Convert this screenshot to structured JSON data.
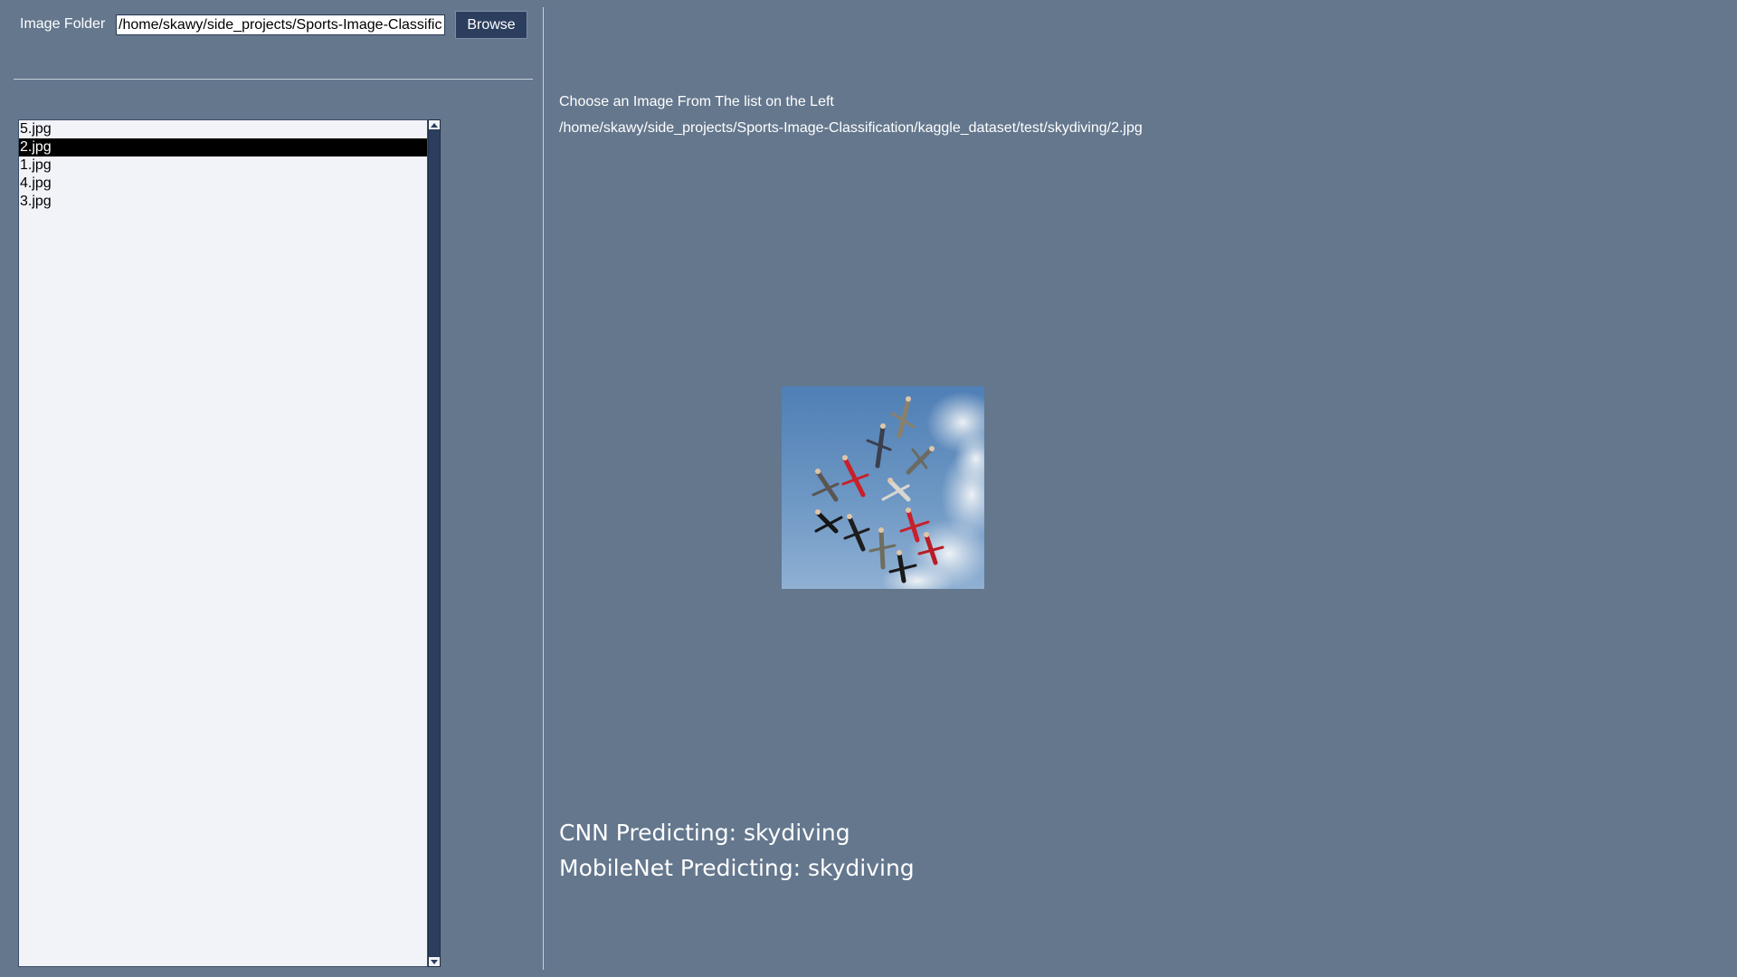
{
  "folder": {
    "label": "Image Folder",
    "path": "/home/skawy/side_projects/Sports-Image-Classification/kaggle_dataset/test/skydiving",
    "browse_label": "Browse"
  },
  "file_list": {
    "items": [
      "5.jpg",
      "2.jpg",
      "1.jpg",
      "4.jpg",
      "3.jpg"
    ],
    "selected": "2.jpg"
  },
  "viewer": {
    "instruction": "Choose an Image From The list on the Left",
    "image_path": "/home/skawy/side_projects/Sports-Image-Classification/kaggle_dataset/test/skydiving/2.jpg",
    "image_alt": "skydivers in circle formation"
  },
  "predictions": {
    "cnn": "CNN Predicting: skydiving",
    "mobilenet": "MobileNet Predicting: skydiving"
  },
  "colors": {
    "background": "#64778d",
    "button": "#2c3e5e",
    "list_background": "#f1f3f8",
    "selection": "#000000"
  }
}
